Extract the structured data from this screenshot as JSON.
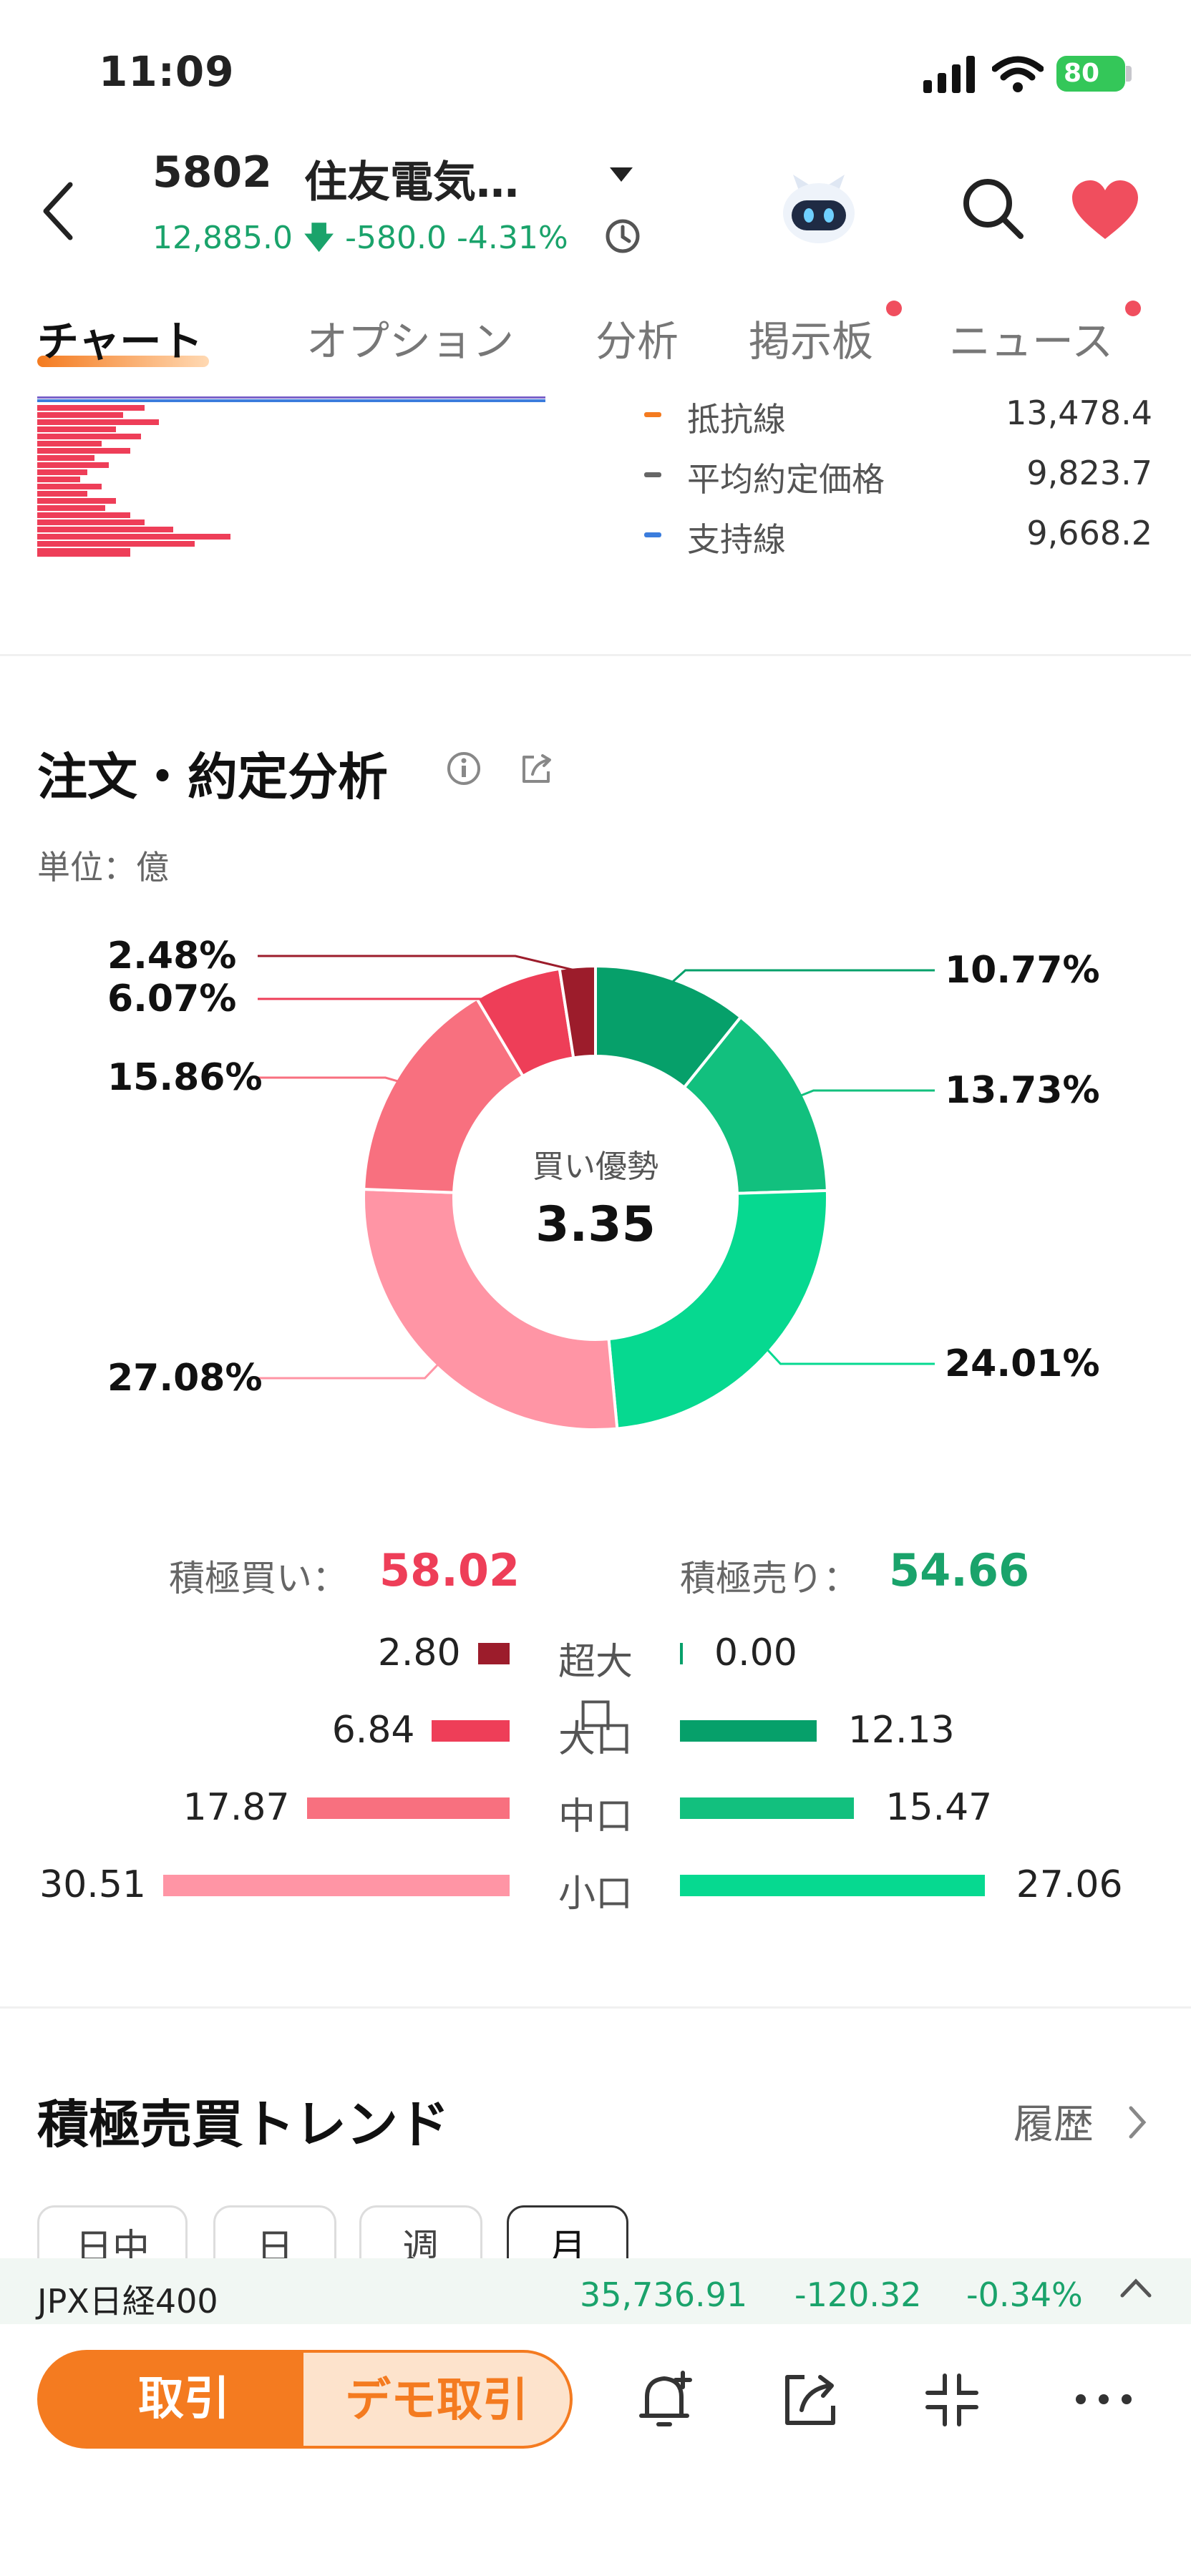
{
  "status": {
    "time": "11:09",
    "battery": "80"
  },
  "header": {
    "code": "5802",
    "name": "住友電気…",
    "price": "12,885.0",
    "change": "-580.0",
    "change_pct": "-4.31%"
  },
  "tabs": [
    {
      "label": "チャート"
    },
    {
      "label": "オプション"
    },
    {
      "label": "分析"
    },
    {
      "label": "掲示板"
    },
    {
      "label": "ニュース"
    }
  ],
  "levels": [
    {
      "label": "抵抗線",
      "value": "13,478.4",
      "color": "#f47b20"
    },
    {
      "label": "平均約定価格",
      "value": "9,823.7",
      "color": "#666666"
    },
    {
      "label": "支持線",
      "value": "9,668.2",
      "color": "#3b7ddd"
    }
  ],
  "analysis": {
    "title": "注文・約定分析",
    "unit": "単位：億",
    "center_label": "買い優勢",
    "center_value": "3.35",
    "donut": [
      {
        "pct": 10.77,
        "label": "10.77%",
        "color": "#06a06a"
      },
      {
        "pct": 13.73,
        "label": "13.73%",
        "color": "#12c07e"
      },
      {
        "pct": 24.01,
        "label": "24.01%",
        "color": "#06d990"
      },
      {
        "pct": 27.08,
        "label": "27.08%",
        "color": "#ff95a5"
      },
      {
        "pct": 15.86,
        "label": "15.86%",
        "color": "#f8707f"
      },
      {
        "pct": 6.07,
        "label": "6.07%",
        "color": "#ee3e58"
      },
      {
        "pct": 2.48,
        "label": "2.48%",
        "color": "#9c1c2b"
      }
    ],
    "buy_label": "積極買い：",
    "buy_total": "58.02",
    "sell_label": "積極売り：",
    "sell_total": "54.66",
    "rows": [
      {
        "label": "超大口",
        "buy": "2.80",
        "sell": "0.00",
        "buy_color": "#9c1c2b",
        "sell_color": "#06a06a"
      },
      {
        "label": "大口",
        "buy": "6.84",
        "sell": "12.13",
        "buy_color": "#ee3e58",
        "sell_color": "#06a06a"
      },
      {
        "label": "中口",
        "buy": "17.87",
        "sell": "15.47",
        "buy_color": "#f8707f",
        "sell_color": "#12c07e"
      },
      {
        "label": "小口",
        "buy": "30.51",
        "sell": "27.06",
        "buy_color": "#ff95a5",
        "sell_color": "#06d990"
      }
    ]
  },
  "trend": {
    "title": "積極売買トレンド",
    "history": "履歴",
    "periods": [
      "日中",
      "日",
      "週",
      "月"
    ]
  },
  "ticker": {
    "name": "JPX日経400",
    "value": "35,736.91",
    "change": "-120.32",
    "pct": "-0.34%"
  },
  "bottom": {
    "trade": "取引",
    "demo": "デモ取引"
  }
}
